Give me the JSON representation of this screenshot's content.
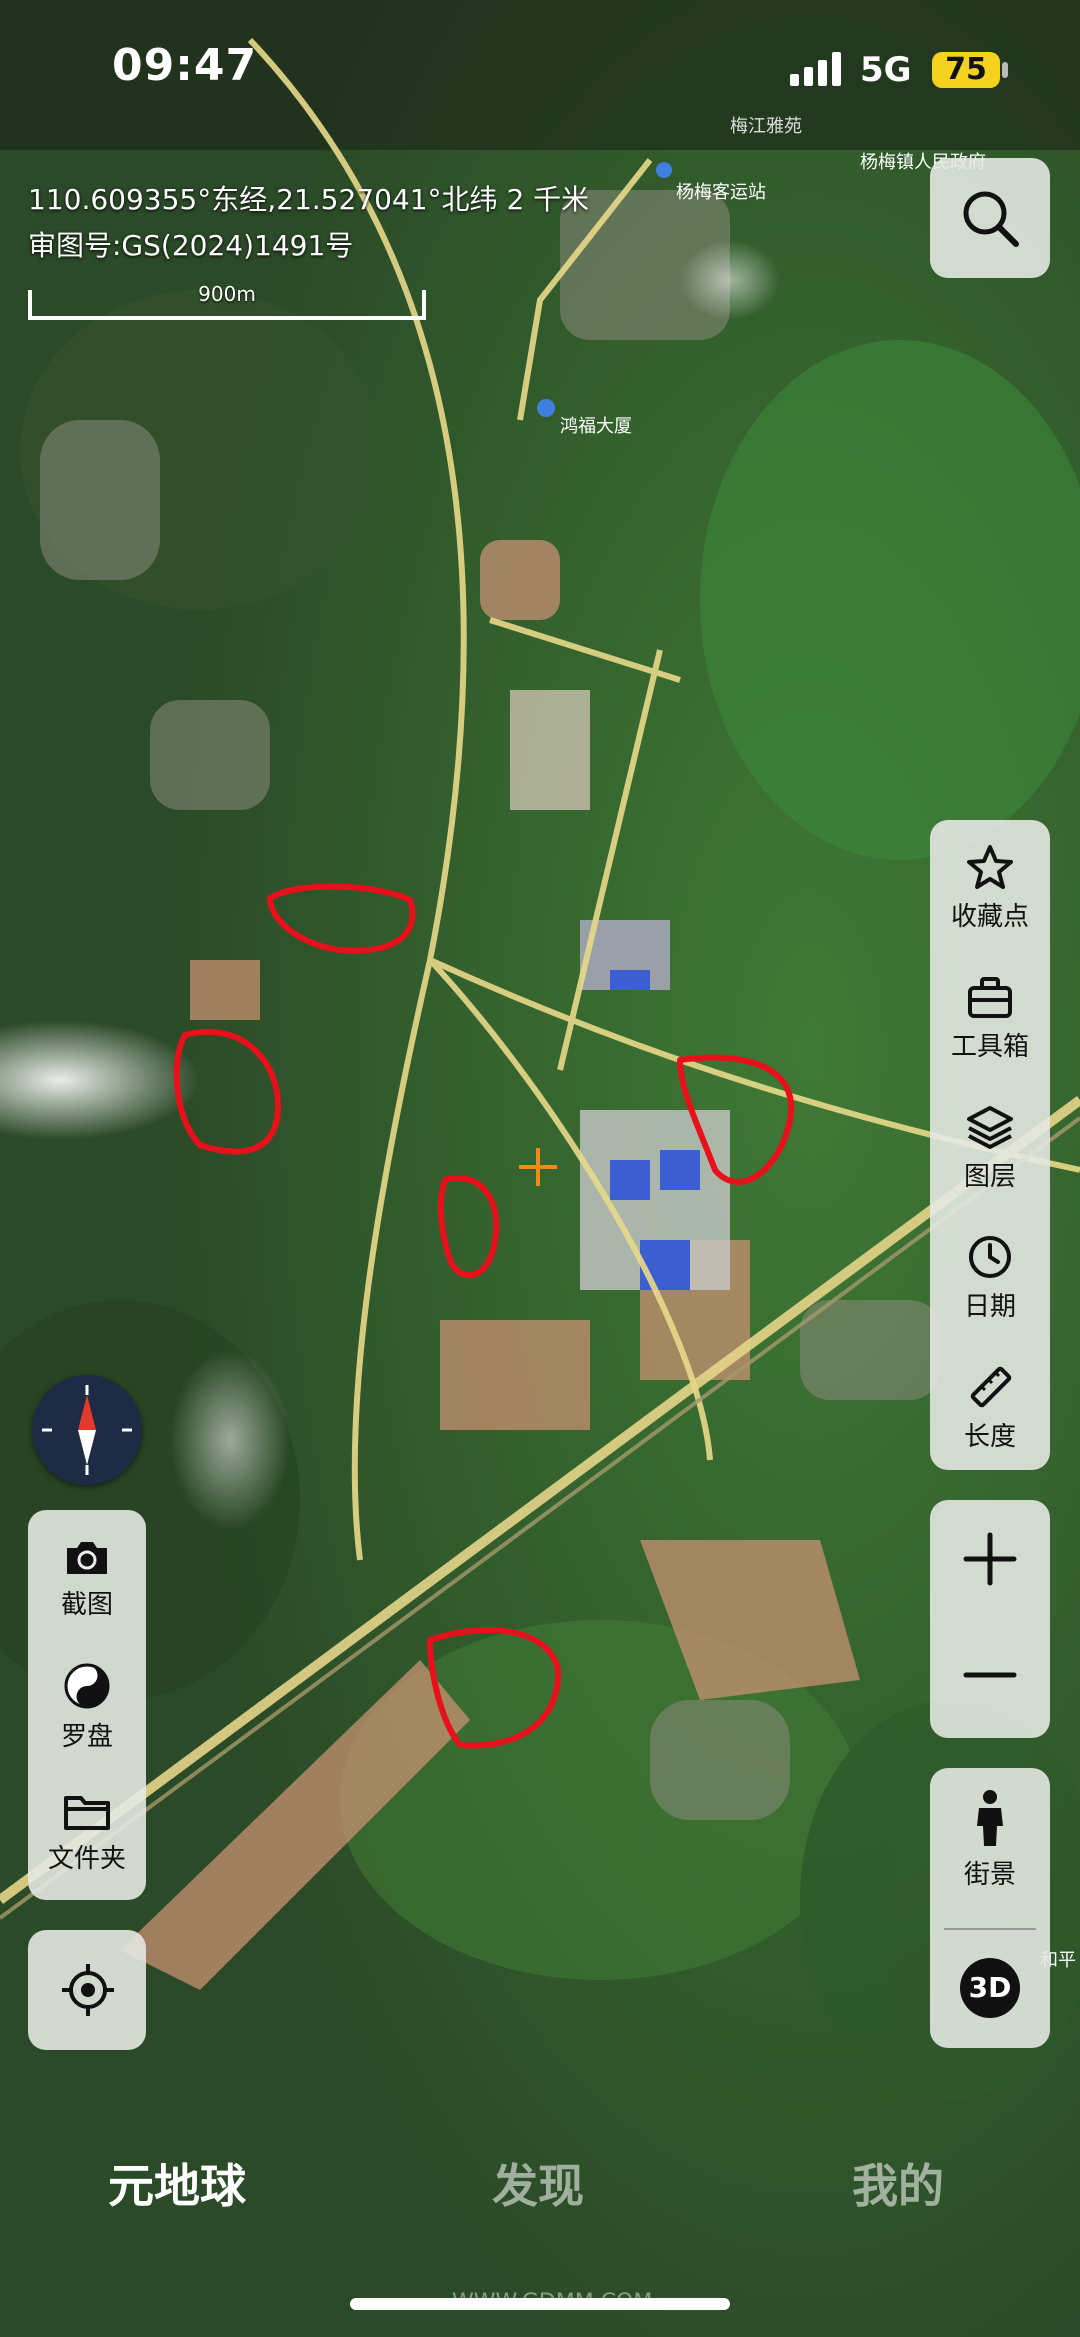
{
  "status_bar": {
    "time": "09:47",
    "network": "5G",
    "battery": "75"
  },
  "map_info": {
    "coordinates": "110.609355°东经,21.527041°北纬 2 千米",
    "approval_number": "审图号:GS(2024)1491号",
    "scale_label": "900m"
  },
  "map_labels": [
    "杨梅镇人民政府",
    "杨梅客运站",
    "梅江雅苑",
    "鸿福大厦",
    "和平"
  ],
  "right_toolbar": {
    "search_icon": "search-icon",
    "items": [
      {
        "label": "收藏点",
        "icon": "star-icon"
      },
      {
        "label": "工具箱",
        "icon": "toolbox-icon"
      },
      {
        "label": "图层",
        "icon": "layers-icon"
      },
      {
        "label": "日期",
        "icon": "clock-icon"
      },
      {
        "label": "长度",
        "icon": "ruler-icon"
      }
    ],
    "zoom": {
      "in_icon": "plus-icon",
      "out_icon": "minus-icon"
    },
    "street_view_label": "街景",
    "three_d_label": "3D"
  },
  "left_toolbar": {
    "items": [
      {
        "label": "截图",
        "icon": "camera-icon"
      },
      {
        "label": "罗盘",
        "icon": "yin-yang-icon"
      },
      {
        "label": "文件夹",
        "icon": "folder-icon"
      }
    ],
    "locate_icon": "locate-icon",
    "compass_icon": "compass-icon"
  },
  "bottom_tabs": [
    {
      "label": "元地球",
      "active": true
    },
    {
      "label": "发现",
      "active": false
    },
    {
      "label": "我的",
      "active": false
    }
  ],
  "watermark": "WWW.GDMM.COM",
  "colors": {
    "annotation": "#e8101a",
    "battery": "#f4d21f",
    "road": "#e8d98a",
    "center_cross": "#f28a1a"
  }
}
